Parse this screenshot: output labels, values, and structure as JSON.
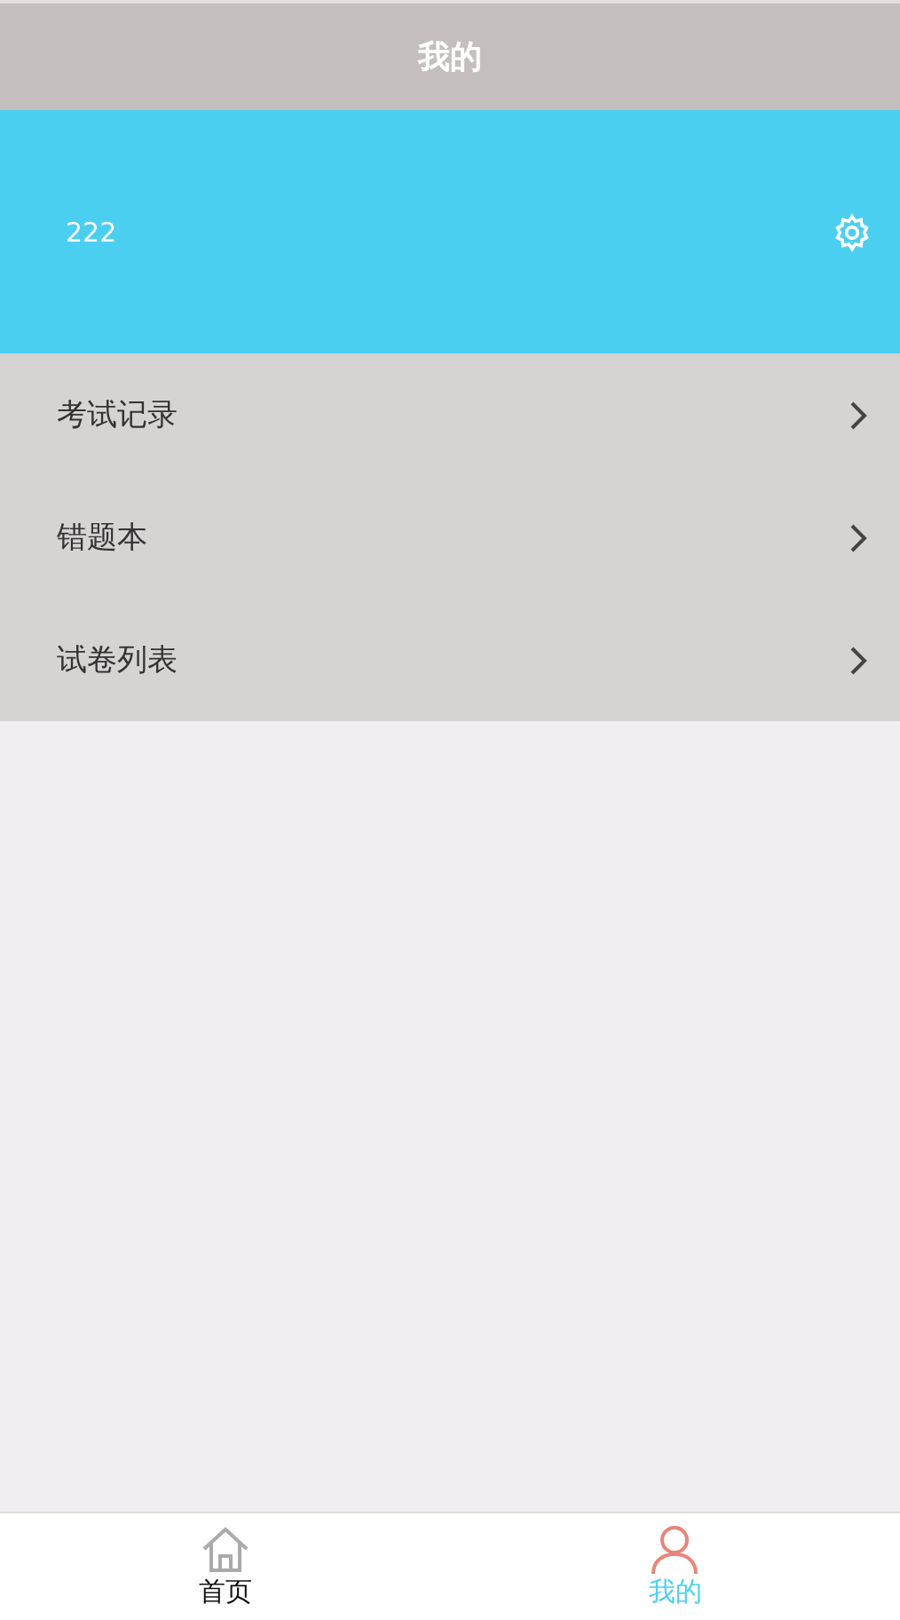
{
  "header": {
    "title": "我的"
  },
  "profile": {
    "username": "222"
  },
  "menu": [
    {
      "label": "考试记录"
    },
    {
      "label": "错题本"
    },
    {
      "label": "试卷列表"
    }
  ],
  "tab_bar": [
    {
      "label": "首页",
      "kind": "home",
      "selected": false
    },
    {
      "label": "我的",
      "kind": "user",
      "selected": true
    }
  ]
}
